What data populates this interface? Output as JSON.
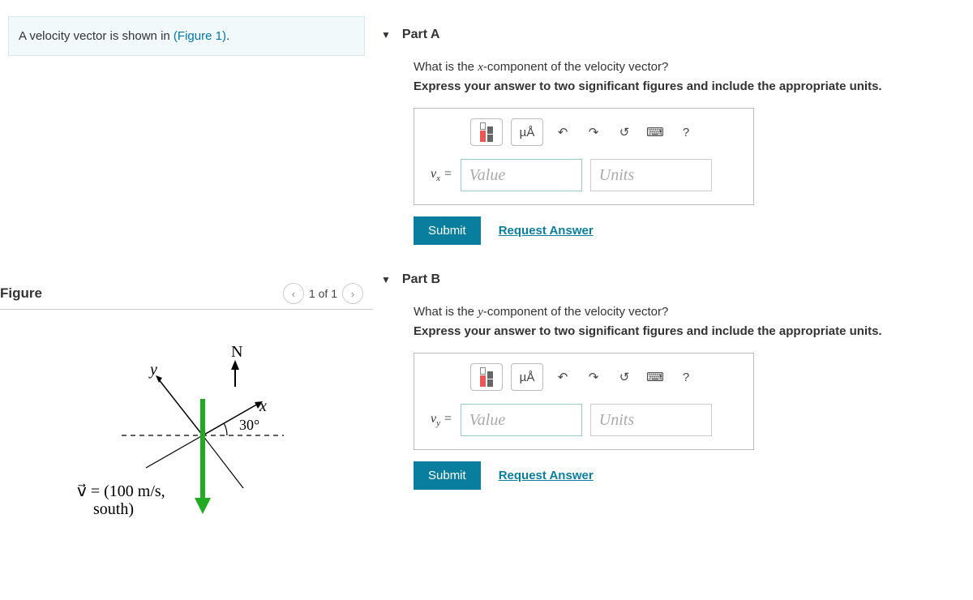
{
  "problem": {
    "prefix": "A velocity vector is shown in ",
    "link": "(Figure 1)",
    "suffix": "."
  },
  "figure": {
    "title": "Figure",
    "pager": "1 of 1",
    "labels": {
      "N": "N",
      "y": "y",
      "x": "x",
      "angle": "30°",
      "vector_line1": "v⃗ = (100 m/s,",
      "vector_line2": "south)"
    }
  },
  "parts": [
    {
      "title": "Part A",
      "question_pre": "What is the ",
      "question_var": "x",
      "question_post": "-component of the velocity vector?",
      "instructions": "Express your answer to two significant figures and include the appropriate units.",
      "lhs_var": "v",
      "lhs_sub": "x",
      "value_placeholder": "Value",
      "units_placeholder": "Units",
      "toolbar": {
        "units_label": "µÅ",
        "help": "?"
      },
      "submit": "Submit",
      "request": "Request Answer"
    },
    {
      "title": "Part B",
      "question_pre": "What is the ",
      "question_var": "y",
      "question_post": "-component of the velocity vector?",
      "instructions": "Express your answer to two significant figures and include the appropriate units.",
      "lhs_var": "v",
      "lhs_sub": "y",
      "value_placeholder": "Value",
      "units_placeholder": "Units",
      "toolbar": {
        "units_label": "µÅ",
        "help": "?"
      },
      "submit": "Submit",
      "request": "Request Answer"
    }
  ]
}
